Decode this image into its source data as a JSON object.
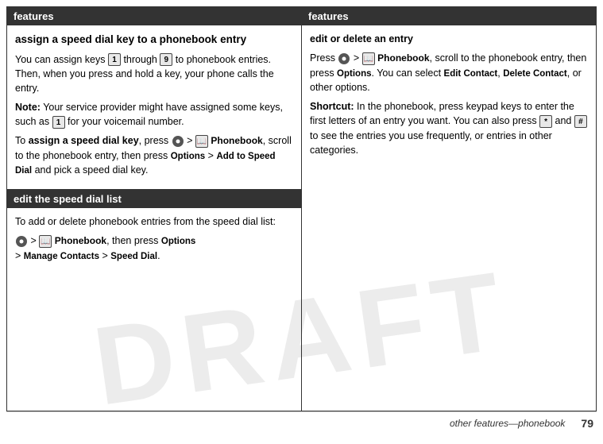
{
  "page": {
    "footer": {
      "text": "other features—phonebook",
      "page_number": "79"
    },
    "draft_label": "DRAFT"
  },
  "left_column": {
    "section1": {
      "header": "features",
      "title": "assign a speed dial key to a phonebook entry",
      "paragraphs": [
        "You can assign keys 1 through 9 to phonebook entries. Then, when you press and hold a key, your phone calls the entry.",
        "Note: Your service provider might have assigned some keys, such as 1 for your voicemail number.",
        "To assign a speed dial key, press •> Phonebook, scroll to the phonebook entry, then press Options > Add to Speed Dial and pick a speed dial key."
      ]
    },
    "section2": {
      "header": "edit the speed dial list",
      "paragraphs": [
        "To add or delete phonebook entries from the speed dial list:",
        "•> Phonebook, then press Options > Manage Contacts > Speed Dial."
      ]
    }
  },
  "right_column": {
    "section1": {
      "header": "features",
      "subsection_title": "edit or delete an entry",
      "paragraphs": [
        "Press •> Phonebook, scroll to the phonebook entry, then press Options. You can select Edit Contact, Delete Contact, or other options.",
        "Shortcut: In the phonebook, press keypad keys to enter the first letters of an entry you want. You can also press * and # to see the entries you use frequently, or entries in other categories."
      ]
    }
  }
}
